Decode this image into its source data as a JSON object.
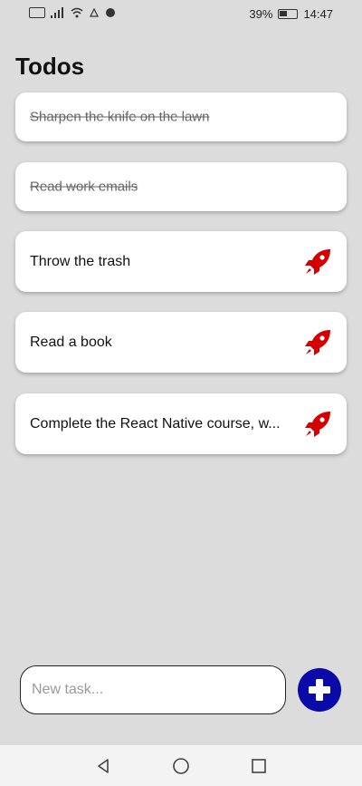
{
  "status_bar": {
    "battery_percent": "39%",
    "time": "14:47"
  },
  "header": {
    "title": "Todos"
  },
  "todos": [
    {
      "text": "Sharpen the knife on the lawn",
      "completed": true
    },
    {
      "text": "Read work emails",
      "completed": true
    },
    {
      "text": "Throw the trash",
      "completed": false,
      "icon": "rocket-icon"
    },
    {
      "text": "Read a book",
      "completed": false,
      "icon": "rocket-icon"
    },
    {
      "text": "Complete the React Native course, w...",
      "completed": false,
      "icon": "rocket-icon"
    }
  ],
  "new_task": {
    "placeholder": "New task...",
    "value": ""
  },
  "add_button": {
    "icon": "plus-icon"
  },
  "colors": {
    "background": "#dcdcdc",
    "card": "#ffffff",
    "rocket": "#d40000",
    "add_button": "#0a0aa8"
  },
  "nav": {
    "icons": [
      "back-icon",
      "home-icon",
      "recents-icon"
    ]
  }
}
